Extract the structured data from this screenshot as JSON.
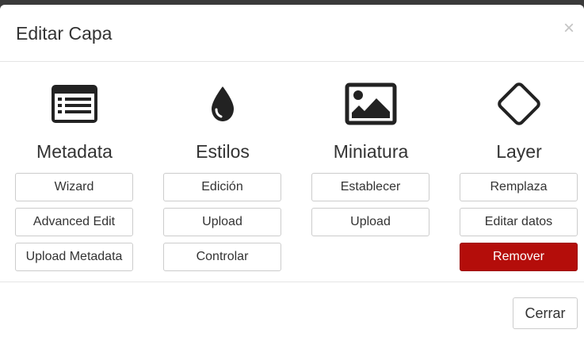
{
  "modal": {
    "title": "Editar Capa",
    "close_symbol": "×"
  },
  "columns": [
    {
      "icon": "list-document-icon",
      "title": "Metadata",
      "buttons": [
        "Wizard",
        "Advanced Edit",
        "Upload Metadata"
      ]
    },
    {
      "icon": "droplet-icon",
      "title": "Estilos",
      "buttons": [
        "Edición",
        "Upload",
        "Controlar"
      ]
    },
    {
      "icon": "image-icon",
      "title": "Miniatura",
      "buttons": [
        "Establecer",
        "Upload"
      ]
    },
    {
      "icon": "diamond-icon",
      "title": "Layer",
      "buttons": [
        "Remplaza",
        "Editar datos",
        "Remover"
      ]
    }
  ],
  "footer": {
    "close_label": "Cerrar"
  },
  "colors": {
    "danger": "#b40d0a",
    "icon": "#222222"
  }
}
